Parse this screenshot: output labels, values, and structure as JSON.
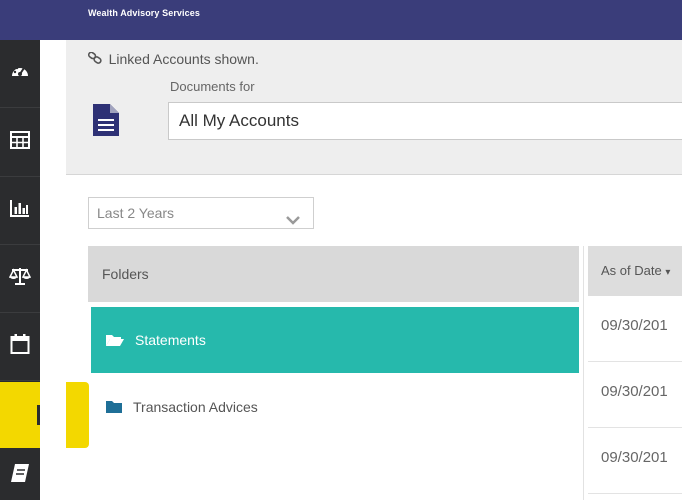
{
  "header": {
    "brand": "Wealth Advisory Services",
    "bg_color": "#3a3d7a"
  },
  "sidebar": {
    "items": [
      {
        "icon": "dashboard-icon"
      },
      {
        "icon": "grid-table-icon"
      },
      {
        "icon": "bar-chart-icon"
      },
      {
        "icon": "balance-scale-icon"
      },
      {
        "icon": "calendar-icon"
      },
      {
        "icon": "document-icon",
        "active": true
      },
      {
        "icon": "notebook-icon"
      }
    ],
    "active_color": "#f3d800"
  },
  "accounts": {
    "linked_text": "Linked Accounts shown.",
    "documents_for_label": "Documents for",
    "selected_account": "All My Accounts"
  },
  "filter": {
    "date_range": "Last 2 Years"
  },
  "folders": {
    "header": "Folders",
    "items": [
      {
        "label": "Statements",
        "selected": true
      },
      {
        "label": "Transaction Advices",
        "selected": false
      }
    ],
    "selected_color": "#26b9ac",
    "folder_icon_color": "#1f6f97"
  },
  "table": {
    "columns": [
      "As of Date"
    ],
    "rows": [
      "09/30/201",
      "09/30/201",
      "09/30/201"
    ]
  }
}
